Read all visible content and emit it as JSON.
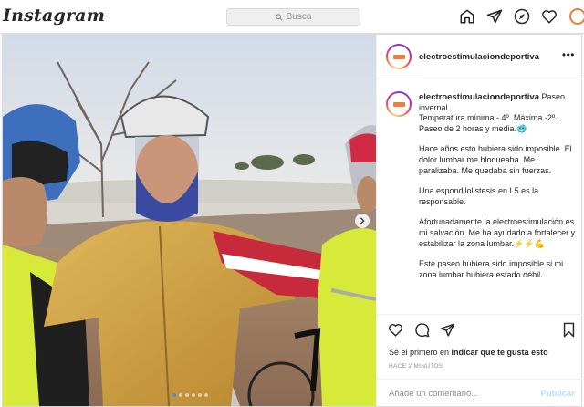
{
  "header": {
    "logo": "Instagram",
    "search_placeholder": "Busca"
  },
  "post": {
    "username": "electroestimulaciondeportiva",
    "caption": [
      "Paseo invernal.\nTemperatura mínima - 4º. Máxima -2º.\nPaseo de 2 horas y media.🥶",
      "Hace años esto hubiera sido imposible. El dolor lumbar me bloqueaba. Me paralizaba. Me quedaba sin fuerzas.",
      "Una espondilolistesis en L5 es la responsable.",
      "Afortunadamente la electroestimulación es mi salvación. Me ha ayudado a fortalecer y estabilizar la zona lumbar.⚡⚡💪",
      "Este paseo hubiera sido imposible si mi zona lumbar hubiera estado débil."
    ],
    "likes_prefix": "Sé el primero en ",
    "likes_link": "indicar que te gusta esto",
    "timestamp": "HACE 2 MINUTOS",
    "comment_placeholder": "Añade un comentario...",
    "publish_label": "Publicar",
    "carousel_count": 6,
    "carousel_active": 1
  },
  "icons": {
    "home": "home-icon",
    "direct": "paper-plane-icon",
    "explore": "compass-icon",
    "activity": "heart-icon",
    "profile": "avatar"
  }
}
